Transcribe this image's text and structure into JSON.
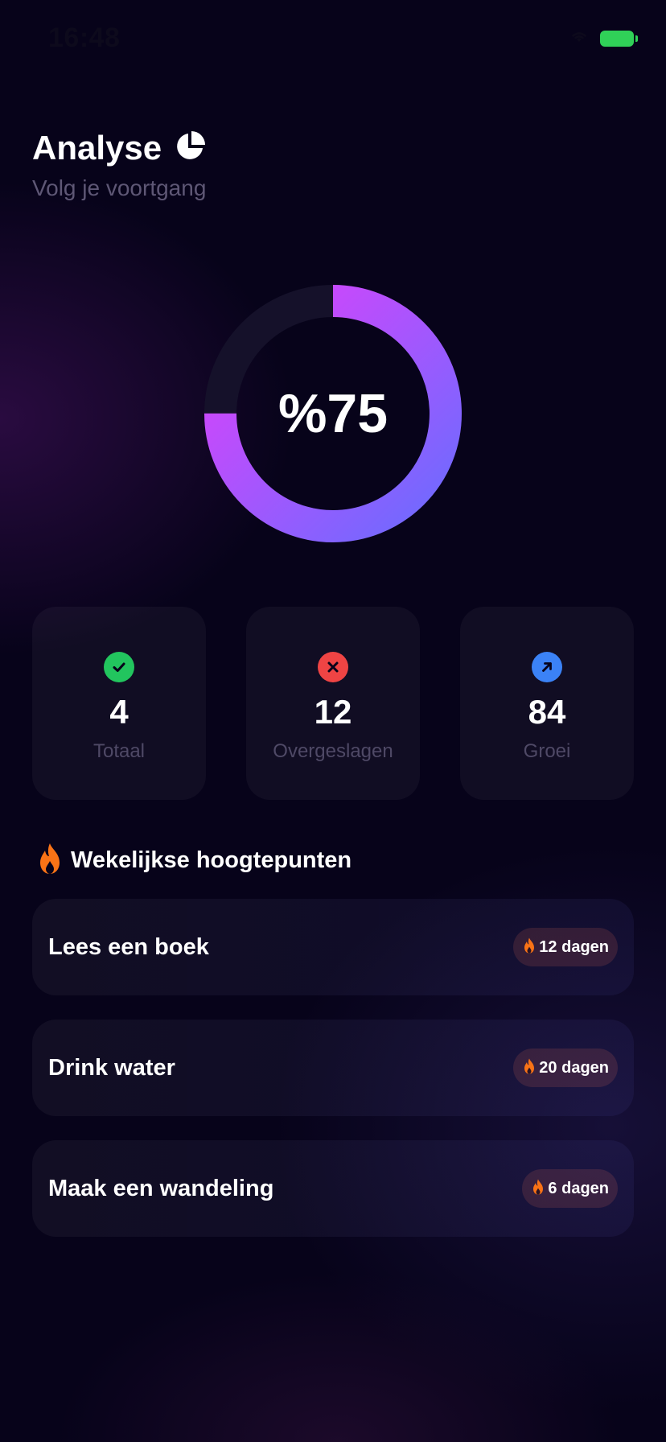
{
  "status_bar": {
    "time": "16:48",
    "icons": [
      "wifi-icon",
      "battery-icon"
    ],
    "battery_color": "#30d158"
  },
  "header": {
    "title": "Analyse",
    "title_icon": "pie-chart-icon",
    "subtitle": "Volg je voortgang"
  },
  "progress": {
    "value": 75,
    "label": "%75",
    "gradient_start": "#6a6cff",
    "gradient_end": "#e040fb",
    "track_color": "#15112a"
  },
  "stats": [
    {
      "value": "4",
      "label": "Totaal",
      "icon": "check-icon",
      "color": "#22c55e"
    },
    {
      "value": "12",
      "label": "Overgeslagen",
      "icon": "close-icon",
      "color": "#ef4444"
    },
    {
      "value": "84",
      "label": "Groei",
      "icon": "arrow-up-right-icon",
      "color": "#3b82f6"
    }
  ],
  "highlights": {
    "title": "Wekelijkse hoogtepunten",
    "icon": "fire-icon",
    "accent": "#f97316",
    "items": [
      {
        "name": "Lees een boek",
        "streak": "12 dagen"
      },
      {
        "name": "Drink water",
        "streak": "20 dagen"
      },
      {
        "name": "Maak een wandeling",
        "streak": "6 dagen"
      }
    ]
  }
}
